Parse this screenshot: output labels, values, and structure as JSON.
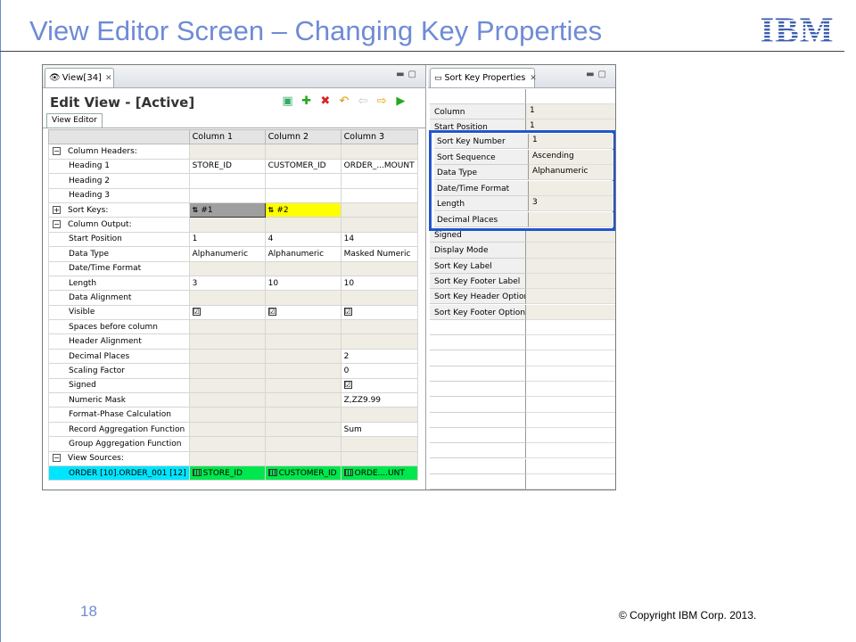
{
  "slide": {
    "title": "View Editor Screen – Changing Key Properties",
    "logo_text": "IBM",
    "page_number": "18",
    "copyright": "© Copyright  IBM Corp. 2013.",
    "accent_color": "#6f8bd6"
  },
  "view_editor": {
    "tab_label": "View[34]",
    "editor_title": "Edit View - [Active]",
    "subtab_label": "View Editor",
    "toolbar_icons": [
      "save-icon",
      "add-icon",
      "delete-icon",
      "undo-icon",
      "move-left-icon",
      "move-right-icon",
      "run-icon"
    ],
    "columns": [
      "Column 1",
      "Column 2",
      "Column 3"
    ],
    "rows": [
      {
        "label": "Column Headers:",
        "section": true,
        "toggle": "−",
        "cells": [
          "",
          "",
          ""
        ]
      },
      {
        "label": "Heading 1",
        "cells": [
          "STORE_ID",
          "CUSTOMER_ID",
          "ORDER_...MOUNT"
        ]
      },
      {
        "label": "Heading 2",
        "cells": [
          "",
          "",
          ""
        ]
      },
      {
        "label": "Heading 3",
        "cells": [
          "",
          "",
          ""
        ]
      },
      {
        "label": "Sort Keys:",
        "section": true,
        "toggle": "+",
        "cells": [
          "#1",
          "#2",
          ""
        ]
      },
      {
        "label": "Column Output:",
        "section": true,
        "toggle": "−",
        "cells": [
          "",
          "",
          ""
        ]
      },
      {
        "label": "Start Position",
        "cells": [
          "1",
          "4",
          "14"
        ]
      },
      {
        "label": "Data Type",
        "cells": [
          "Alphanumeric",
          "Alphanumeric",
          "Masked Numeric"
        ]
      },
      {
        "label": "Date/Time Format",
        "cells": [
          "",
          "",
          ""
        ]
      },
      {
        "label": "Length",
        "cells": [
          "3",
          "10",
          "10"
        ]
      },
      {
        "label": "Data Alignment",
        "cells": [
          "",
          "",
          ""
        ]
      },
      {
        "label": "Visible",
        "cells": [
          "☑",
          "☑",
          "☑"
        ]
      },
      {
        "label": "Spaces before column",
        "cells": [
          "",
          "",
          ""
        ]
      },
      {
        "label": "Header Alignment",
        "cells": [
          "",
          "",
          ""
        ]
      },
      {
        "label": "Decimal Places",
        "cells": [
          "",
          "",
          "2"
        ]
      },
      {
        "label": "Scaling Factor",
        "cells": [
          "",
          "",
          "0"
        ]
      },
      {
        "label": "Signed",
        "cells": [
          "",
          "",
          "☑"
        ]
      },
      {
        "label": "Numeric Mask",
        "cells": [
          "",
          "",
          "Z,ZZ9.99"
        ]
      },
      {
        "label": "Format-Phase Calculation",
        "cells": [
          "",
          "",
          ""
        ]
      },
      {
        "label": "Record Aggregation Function",
        "cells": [
          "",
          "",
          "Sum"
        ]
      },
      {
        "label": "Group Aggregation Function",
        "cells": [
          "",
          "",
          ""
        ]
      },
      {
        "label": "View Sources:",
        "section": true,
        "toggle": "−",
        "cells": [
          "",
          "",
          ""
        ]
      },
      {
        "label": "ORDER [10].ORDER_001 [12]",
        "source": true,
        "cells": [
          "STORE_ID",
          "CUSTOMER_ID",
          "ORDE....UNT"
        ]
      }
    ]
  },
  "sort_key_properties": {
    "tab_label": "Sort Key Properties",
    "background_rows": [
      {
        "key": "Column",
        "value": "1"
      },
      {
        "key": "Start Position",
        "value": "1"
      }
    ],
    "highlighted_rows": [
      {
        "key": "Sort Key Number",
        "value": "1"
      },
      {
        "key": "Sort Sequence",
        "value": "Ascending"
      },
      {
        "key": "Data Type",
        "value": "Alphanumeric"
      },
      {
        "key": "Date/Time Format",
        "value": ""
      },
      {
        "key": "Length",
        "value": "3"
      },
      {
        "key": "Decimal Places",
        "value": ""
      }
    ],
    "lower_rows": [
      {
        "key": "Signed",
        "value": ""
      },
      {
        "key": "Display Mode",
        "value": ""
      },
      {
        "key": "Sort Key Label",
        "value": ""
      },
      {
        "key": "Sort Key Footer Label",
        "value": ""
      },
      {
        "key": "Sort Key Header Option",
        "value": ""
      },
      {
        "key": "Sort Key Footer Option",
        "value": ""
      }
    ],
    "highlight_color": "#2255cc"
  }
}
